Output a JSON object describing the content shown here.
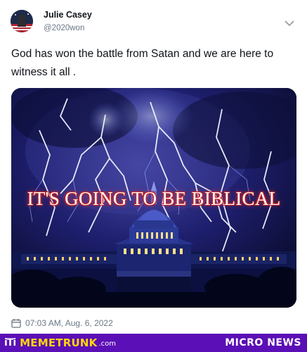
{
  "tweet": {
    "author_name": "Julie Casey",
    "author_handle": "@2020won",
    "text": "God has won the battle from Satan and we are here to witness it all .",
    "timestamp": "07:03 AM, Aug. 6, 2022"
  },
  "media": {
    "overlay_text": "IT'S GOING TO BE BIBLICAL",
    "overlay_color": "#ffffff",
    "overlay_outline_color": "#c02020"
  },
  "icons": {
    "more": "chevron-down-icon",
    "date": "calendar-icon"
  },
  "footer": {
    "logo_mark": "iTi",
    "brand": "MEMETRUNK",
    "brand_tld": ".com",
    "section": "MICRO NEWS",
    "background_color": "#5b0fb6",
    "brand_color": "#ffd60a"
  }
}
